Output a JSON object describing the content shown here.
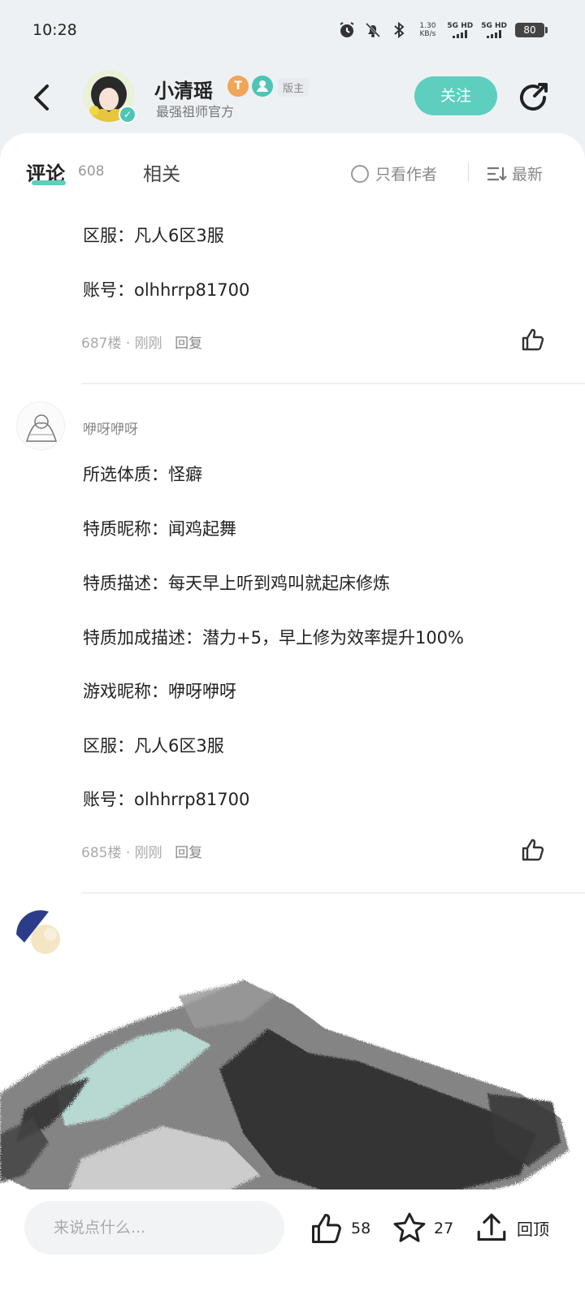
{
  "status": {
    "time": "10:28",
    "net_speed_value": "1.30",
    "net_speed_unit": "KB/s",
    "sim1": "5G HD",
    "sim2": "5G HD",
    "battery": "80"
  },
  "header": {
    "user_name": "小清瑶",
    "level_badge": "T",
    "moderator_label": "版主",
    "subtitle": "最强祖师官方",
    "follow_label": "关注"
  },
  "tabs": {
    "comments_label": "评论",
    "comments_count": "608",
    "related_label": "相关",
    "author_only_label": "只看作者",
    "sort_label": "最新"
  },
  "comments": [
    {
      "lines": [
        "区服：凡人6区3服",
        "账号：olhhrrp81700"
      ],
      "floor": "687楼",
      "time": "刚刚",
      "reply": "回复"
    },
    {
      "user": "咿呀咿呀",
      "lines": [
        "所选体质：怪癖",
        "特质昵称：闻鸡起舞",
        "特质描述：每天早上听到鸡叫就起床修炼",
        "特质加成描述：潜力+5，早上修为效率提升100%",
        "游戏昵称：咿呀咿呀",
        "区服：凡人6区3服",
        "账号：olhhrrp81700"
      ],
      "floor": "685楼",
      "time": "刚刚",
      "reply": "回复"
    }
  ],
  "bottom_bar": {
    "input_placeholder": "来说点什么...",
    "like_count": "58",
    "star_count": "27",
    "top_label": "回顶"
  },
  "colors": {
    "accent": "#5ecfbf",
    "background": "#eef1f4",
    "card": "#ffffff"
  }
}
